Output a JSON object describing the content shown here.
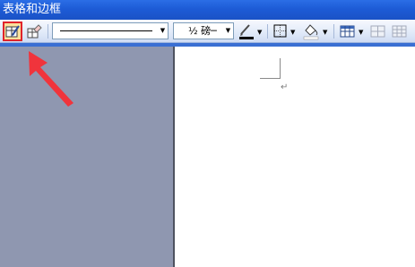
{
  "window": {
    "title": "表格和边框"
  },
  "toolbar": {
    "line_weight_value": "½ 磅─",
    "icons": [
      "draw-table-icon",
      "eraser-icon",
      "border-color-icon",
      "borders-icon",
      "shading-color-icon",
      "insert-table-icon",
      "merge-cells-icon",
      "split-cells-icon"
    ]
  },
  "document": {
    "paragraph_mark": "↵"
  },
  "colors": {
    "title_bar": "#1d5bd6",
    "highlight_box": "#e0242b",
    "annotation_arrow": "#f0343c",
    "left_panel": "#8f97b0"
  }
}
